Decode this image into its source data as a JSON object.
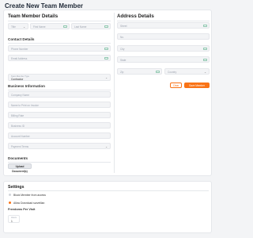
{
  "page_title": "Create New Team Member",
  "team_member": {
    "heading": "Team Member Details",
    "title_placeholder": "Title",
    "first_name_placeholder": "First Name",
    "last_name_placeholder": "Last Name",
    "contact_heading": "Contact Details",
    "phone_placeholder": "Phone Number",
    "email_placeholder": "Email Address",
    "member_type_label": "Team Member Type",
    "member_type_value": "Contractor",
    "business_heading": "Business Information",
    "company_placeholder": "Company Name",
    "invoice_name_placeholder": "Name to Print on Invoice",
    "billing_rate_placeholder": "Billing Rate",
    "business_id_placeholder": "Business ID",
    "account_number_placeholder": "Account Number",
    "payment_terms_placeholder": "Payment Terms",
    "documents_heading": "Documents",
    "upload_label": "Upload Document(s)"
  },
  "address": {
    "heading": "Address Details",
    "street_placeholder": "Street",
    "no_placeholder": "No.",
    "city_placeholder": "City",
    "state_placeholder": "State",
    "zip_placeholder": "Zip",
    "country_placeholder": "Country",
    "cancel_label": "Clear",
    "save_label": "Save Member"
  },
  "settings": {
    "heading": "Settings",
    "option_1": "Block Member from access",
    "option_2": "Allow Download surveillan",
    "option_1_enabled": false,
    "option_2_enabled": true,
    "freedom_heading": "Freedoms Per Visit",
    "hours_label": "Hours",
    "hours_value": "1"
  },
  "colors": {
    "accent": "#f97316",
    "field_bg": "#f3f4f6",
    "keyboard_icon": "#2f9e6a"
  }
}
